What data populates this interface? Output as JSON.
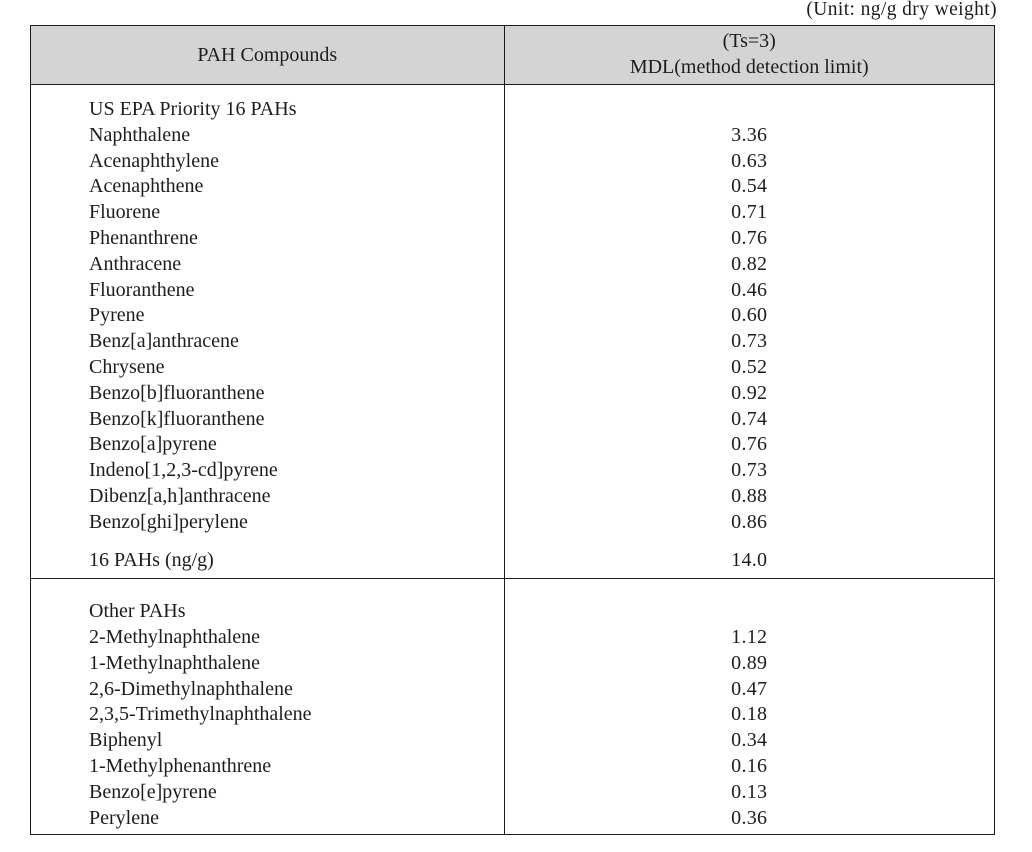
{
  "unit_caption": "(Unit: ng/g dry weight)",
  "header": {
    "name_column": "PAH Compounds",
    "value_column_line1": "(Ts=3)",
    "value_column_line2": "MDL(method detection limit)"
  },
  "colors": {
    "header_background": "#d4d4d4",
    "border": "#1a1a1a",
    "text": "#1d1d1d",
    "page_background": "#ffffff"
  },
  "sections": [
    {
      "id": "us-epa-priority-16-pahs",
      "title": "US EPA Priority 16 PAHs",
      "title_value": "",
      "rows": [
        {
          "compound": "Naphthalene",
          "mdl": "3.36"
        },
        {
          "compound": "Acenaphthylene",
          "mdl": "0.63"
        },
        {
          "compound": "Acenaphthene",
          "mdl": "0.54"
        },
        {
          "compound": "Fluorene",
          "mdl": "0.71"
        },
        {
          "compound": "Phenanthrene",
          "mdl": "0.76"
        },
        {
          "compound": "Anthracene",
          "mdl": "0.82"
        },
        {
          "compound": "Fluoranthene",
          "mdl": "0.46"
        },
        {
          "compound": "Pyrene",
          "mdl": "0.60"
        },
        {
          "compound": "Benz[a]anthracene",
          "mdl": "0.73"
        },
        {
          "compound": "Chrysene",
          "mdl": "0.52"
        },
        {
          "compound": "Benzo[b]fluoranthene",
          "mdl": "0.92"
        },
        {
          "compound": "Benzo[k]fluoranthene",
          "mdl": "0.74"
        },
        {
          "compound": "Benzo[a]pyrene",
          "mdl": "0.76"
        },
        {
          "compound": "Indeno[1,2,3-cd]pyrene",
          "mdl": "0.73"
        },
        {
          "compound": "Dibenz[a,h]anthracene",
          "mdl": "0.88"
        },
        {
          "compound": "Benzo[ghi]perylene",
          "mdl": "0.86"
        }
      ],
      "summary": {
        "compound": "16 PAHs (ng/g)",
        "mdl": "14.0"
      }
    },
    {
      "id": "other-pahs",
      "title": "Other PAHs",
      "title_value": "",
      "rows": [
        {
          "compound": "2-Methylnaphthalene",
          "mdl": "1.12"
        },
        {
          "compound": "1-Methylnaphthalene",
          "mdl": "0.89"
        },
        {
          "compound": "2,6-Dimethylnaphthalene",
          "mdl": "0.47"
        },
        {
          "compound": "2,3,5-Trimethylnaphthalene",
          "mdl": "0.18"
        },
        {
          "compound": "Biphenyl",
          "mdl": "0.34"
        },
        {
          "compound": "1-Methylphenanthrene",
          "mdl": "0.16"
        },
        {
          "compound": "Benzo[e]pyrene",
          "mdl": "0.13"
        },
        {
          "compound": "Perylene",
          "mdl": "0.36"
        }
      ],
      "summary": null
    }
  ]
}
